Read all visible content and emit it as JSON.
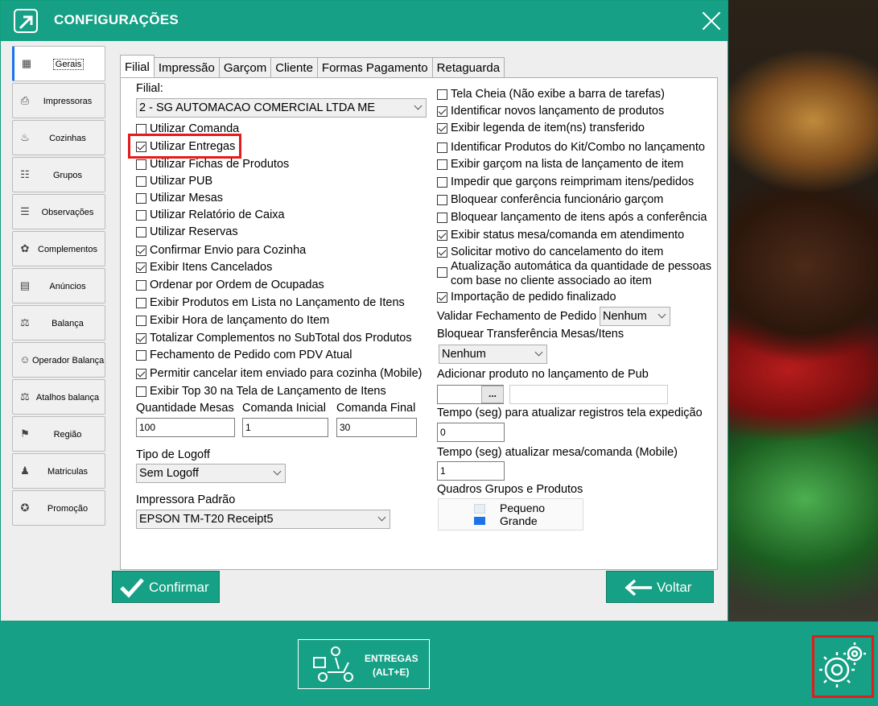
{
  "window": {
    "title": "CONFIGURAÇÕES"
  },
  "sidebar": {
    "items": [
      {
        "label": "Gerais",
        "icon": "settings-panel-icon"
      },
      {
        "label": "Impressoras",
        "icon": "printer-icon"
      },
      {
        "label": "Cozinhas",
        "icon": "kitchen-icon"
      },
      {
        "label": "Grupos",
        "icon": "groups-icon"
      },
      {
        "label": "Observações",
        "icon": "clipboard-icon"
      },
      {
        "label": "Complementos",
        "icon": "food-icon"
      },
      {
        "label": "Anúncios",
        "icon": "document-icon"
      },
      {
        "label": "Balança",
        "icon": "scale-icon"
      },
      {
        "label": "Operador Balança",
        "icon": "operator-icon"
      },
      {
        "label": "Atalhos balança",
        "icon": "shortcut-scale-icon"
      },
      {
        "label": "Região",
        "icon": "flag-icon"
      },
      {
        "label": "Matriculas",
        "icon": "registration-icon"
      },
      {
        "label": "Promoção",
        "icon": "promotion-icon"
      }
    ]
  },
  "tabs": [
    "Filial",
    "Impressão",
    "Garçom",
    "Cliente",
    "Formas Pagamento",
    "Retaguarda"
  ],
  "left": {
    "filial_label": "Filial:",
    "filial_value": "2 - SG AUTOMACAO COMERCIAL LTDA ME",
    "checkboxes": [
      {
        "label": "Utilizar Comanda",
        "checked": false
      },
      {
        "label": "Utilizar Entregas",
        "checked": true
      },
      {
        "label": "Utilizar Fichas de Produtos",
        "checked": false
      },
      {
        "label": "Utilizar PUB",
        "checked": false
      },
      {
        "label": "Utilizar Mesas",
        "checked": false
      },
      {
        "label": "Utilizar Relatório de Caixa",
        "checked": false
      },
      {
        "label": "Utilizar Reservas",
        "checked": false
      },
      {
        "label": "Confirmar Envio para Cozinha",
        "checked": true
      },
      {
        "label": "Exibir Itens Cancelados",
        "checked": true
      },
      {
        "label": "Ordenar por Ordem de Ocupadas",
        "checked": false
      },
      {
        "label": "Exibir Produtos em Lista no Lançamento de Itens",
        "checked": false
      },
      {
        "label": "Exibir Hora de lançamento do Item",
        "checked": false
      },
      {
        "label": "Totalizar Complementos no SubTotal dos Produtos",
        "checked": true
      },
      {
        "label": "Fechamento de Pedido com PDV Atual",
        "checked": false
      },
      {
        "label": "Permitir cancelar item enviado para cozinha (Mobile)",
        "checked": true
      },
      {
        "label": "Exibir Top 30 na Tela de Lançamento de Itens",
        "checked": false
      }
    ],
    "qtd_mesas_label": "Quantidade Mesas",
    "qtd_mesas_value": "100",
    "comanda_inicial_label": "Comanda Inicial",
    "comanda_inicial_value": "1",
    "comanda_final_label": "Comanda Final",
    "comanda_final_value": "30",
    "logoff_label": "Tipo de Logoff",
    "logoff_value": "Sem Logoff",
    "impressora_label": "Impressora Padrão",
    "impressora_value": "EPSON TM-T20 Receipt5"
  },
  "right": {
    "checkboxes": [
      {
        "label": "Tela Cheia (Não exibe a barra de tarefas)",
        "checked": false
      },
      {
        "label": "Identificar novos lançamento de produtos",
        "checked": true
      },
      {
        "label": "Exibir legenda de item(ns) transferido",
        "checked": true
      },
      {
        "label": "Identificar Produtos do Kit/Combo no lançamento",
        "checked": false
      },
      {
        "label": "Exibir garçom na lista de lançamento de item",
        "checked": false
      },
      {
        "label": "Impedir que garçons reimprimam itens/pedidos",
        "checked": false
      },
      {
        "label": "Bloquear conferência funcionário garçom",
        "checked": false
      },
      {
        "label": "Bloquear lançamento de itens após a conferência",
        "checked": false
      },
      {
        "label": "Exibir status mesa/comanda em atendimento",
        "checked": true
      },
      {
        "label": "Solicitar motivo do cancelamento do item",
        "checked": true
      }
    ],
    "auto_update_line1": "Atualização automática da quantidade de pessoas",
    "auto_update_line2": "com base no cliente associado ao item",
    "auto_update_checked": false,
    "importacao_label": "Importação de pedido finalizado",
    "importacao_checked": true,
    "validar_label": "Validar Fechamento de Pedido",
    "validar_value": "Nenhum",
    "bloquear_transf_label": "Bloquear Transferência Mesas/Itens",
    "bloquear_transf_value": "Nenhum",
    "adicionar_pub_label": "Adicionar produto no lançamento de Pub",
    "browse_label": "...",
    "tempo_expedicao_label": "Tempo (seg) para atualizar registros tela expedição",
    "tempo_expedicao_value": "0",
    "tempo_mobile_label": "Tempo (seg) atualizar mesa/comanda (Mobile)",
    "tempo_mobile_value": "1",
    "quadros_label": "Quadros Grupos e Produtos",
    "quadros_options": [
      "Pequeno",
      "Grande"
    ]
  },
  "buttons": {
    "confirmar": "Confirmar",
    "voltar": "Voltar"
  },
  "bottom": {
    "entregas_line1": "ENTREGAS",
    "entregas_line2": "(ALT+E)"
  },
  "colors": {
    "accent": "#16a085",
    "highlight": "#e41b1b"
  }
}
